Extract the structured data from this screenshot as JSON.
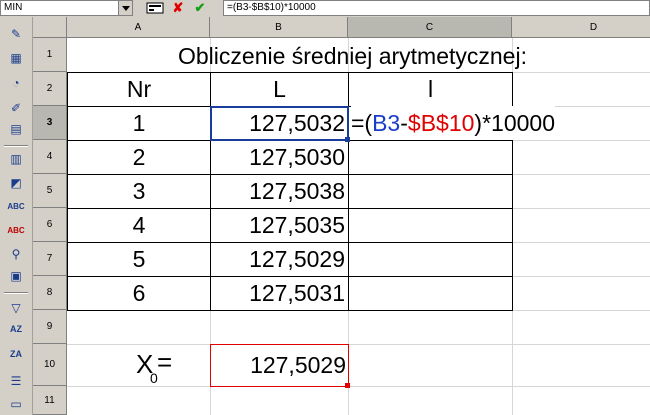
{
  "formula_bar": {
    "name_box": "MIN",
    "formula": "=(B3-$B$10)*10000"
  },
  "columns": [
    "A",
    "B",
    "C",
    "D"
  ],
  "rows": [
    "1",
    "2",
    "3",
    "4",
    "5",
    "6",
    "7",
    "8",
    "9",
    "10",
    "11"
  ],
  "sheet": {
    "title": "Obliczenie średniej arytmetycznej:",
    "headers": {
      "nr": "Nr",
      "L": "L",
      "l": "l"
    },
    "data": [
      {
        "nr": "1",
        "L": "127,5032"
      },
      {
        "nr": "2",
        "L": "127,5030"
      },
      {
        "nr": "3",
        "L": "127,5038"
      },
      {
        "nr": "4",
        "L": "127,5035"
      },
      {
        "nr": "5",
        "L": "127,5029"
      },
      {
        "nr": "6",
        "L": "127,5031"
      }
    ],
    "mean_label": "X",
    "mean_subscript": "0",
    "mean_equals": "=",
    "mean_value": "127,5029",
    "formula_parts": {
      "open": "=(",
      "ref1": "B3",
      "minus": "-",
      "ref2": "$B$10",
      "close": ")*10000"
    }
  },
  "colors": {
    "ref1": "#1a3cc8",
    "ref2": "#e00000",
    "cursor": "#1a3c9c"
  }
}
